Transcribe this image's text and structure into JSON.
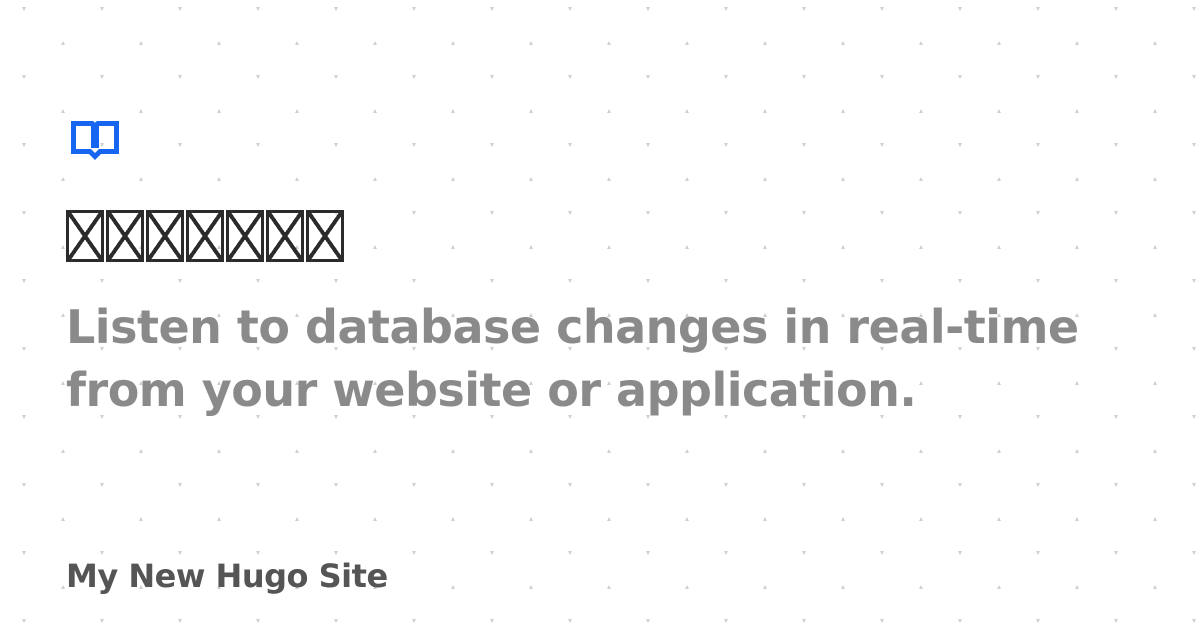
{
  "card": {
    "title": "□□□□□□□",
    "description": "Listen to database changes in real-time from your website or application.",
    "site_name": "My New Hugo Site",
    "logo_icon": "book-icon",
    "colors": {
      "accent": "#1766f1",
      "title": "#2b2b2b",
      "description": "#8a8a8a",
      "site_name": "#555555",
      "background": "#ffffff",
      "pattern_dots": "#cfcfcf"
    }
  }
}
